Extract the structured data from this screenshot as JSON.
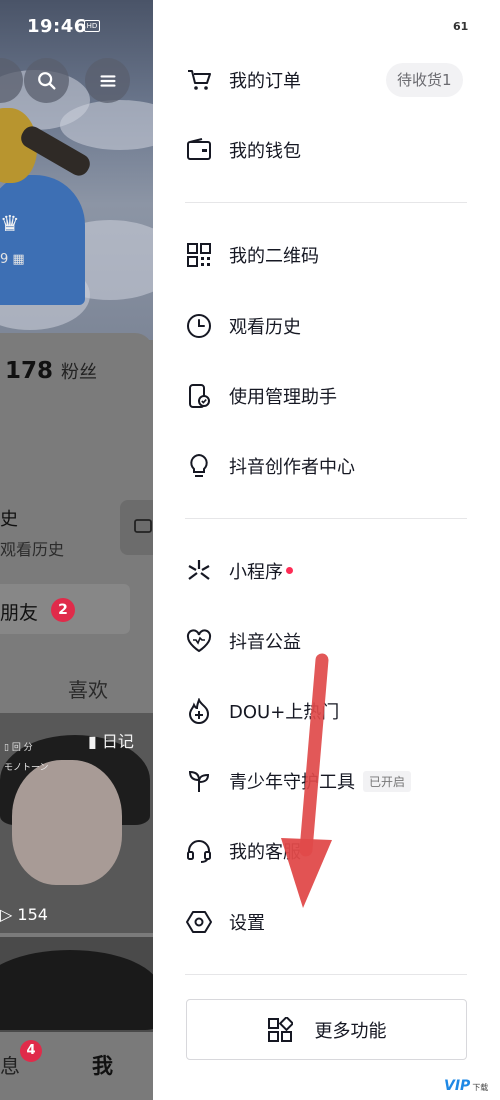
{
  "status": {
    "time": "19:46",
    "badge": "HD",
    "battery": "61"
  },
  "profile": {
    "followers_count": "178",
    "followers_label": "粉丝",
    "history_title": "史",
    "history_sub": "观看历史",
    "friend_label": "朋友",
    "friend_badge": "2",
    "likes_tab": "喜欢",
    "video_tag": "日记",
    "video_plays": "154",
    "nav_message": "息",
    "nav_message_badge": "4",
    "nav_me": "我"
  },
  "drawer": {
    "orders": {
      "label": "我的订单",
      "pill": "待收货1"
    },
    "wallet": {
      "label": "我的钱包"
    },
    "qrcode": {
      "label": "我的二维码"
    },
    "history": {
      "label": "观看历史"
    },
    "assistant": {
      "label": "使用管理助手"
    },
    "creator": {
      "label": "抖音创作者中心"
    },
    "miniapp": {
      "label": "小程序"
    },
    "charity": {
      "label": "抖音公益"
    },
    "douplus": {
      "label": "DOU+上热门"
    },
    "teen": {
      "label": "青少年守护工具",
      "tag": "已开启"
    },
    "service": {
      "label": "我的客服"
    },
    "settings": {
      "label": "设置"
    },
    "more": {
      "label": "更多功能"
    }
  },
  "watermark": {
    "brand": "VIP",
    "text": "下载"
  },
  "colors": {
    "accent_red": "#fe2c55",
    "arrow": "#e04a4a"
  }
}
